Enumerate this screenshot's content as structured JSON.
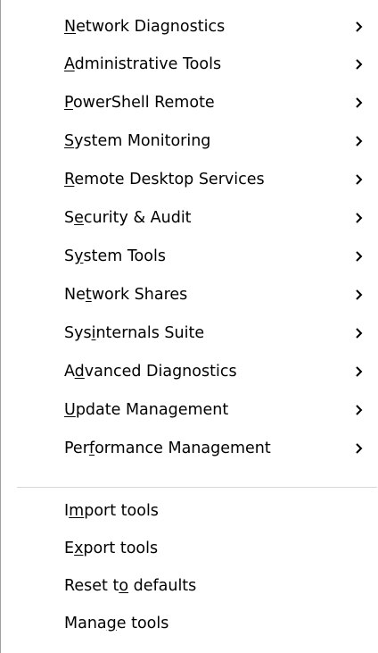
{
  "menu": {
    "submenu_items": [
      {
        "pre": "",
        "key": "N",
        "post": "etwork Diagnostics",
        "icon": "chevron-right-icon"
      },
      {
        "pre": "",
        "key": "A",
        "post": "dministrative Tools",
        "icon": "chevron-right-icon"
      },
      {
        "pre": "",
        "key": "P",
        "post": "owerShell Remote",
        "icon": "chevron-right-icon"
      },
      {
        "pre": "",
        "key": "S",
        "post": "ystem Monitoring",
        "icon": "chevron-right-icon"
      },
      {
        "pre": "",
        "key": "R",
        "post": "emote Desktop Services",
        "icon": "chevron-right-icon"
      },
      {
        "pre": "S",
        "key": "e",
        "post": "curity & Audit",
        "icon": "chevron-right-icon"
      },
      {
        "pre": "S",
        "key": "y",
        "post": "stem Tools",
        "icon": "chevron-right-icon"
      },
      {
        "pre": "Ne",
        "key": "t",
        "post": "work Shares",
        "icon": "chevron-right-icon"
      },
      {
        "pre": "Sys",
        "key": "i",
        "post": "nternals Suite",
        "icon": "chevron-right-icon"
      },
      {
        "pre": "A",
        "key": "d",
        "post": "vanced Diagnostics",
        "icon": "chevron-right-icon"
      },
      {
        "pre": "",
        "key": "U",
        "post": "pdate Management",
        "icon": "chevron-right-icon"
      },
      {
        "pre": "Per",
        "key": "f",
        "post": "ormance Management",
        "icon": "chevron-right-icon"
      }
    ],
    "action_items": [
      {
        "pre": "I",
        "key": "m",
        "post": "port tools"
      },
      {
        "pre": "E",
        "key": "x",
        "post": "port tools"
      },
      {
        "pre": "Reset t",
        "key": "o",
        "post": " defaults"
      },
      {
        "pre": "Mana",
        "key": "g",
        "post": "e tools"
      }
    ]
  }
}
